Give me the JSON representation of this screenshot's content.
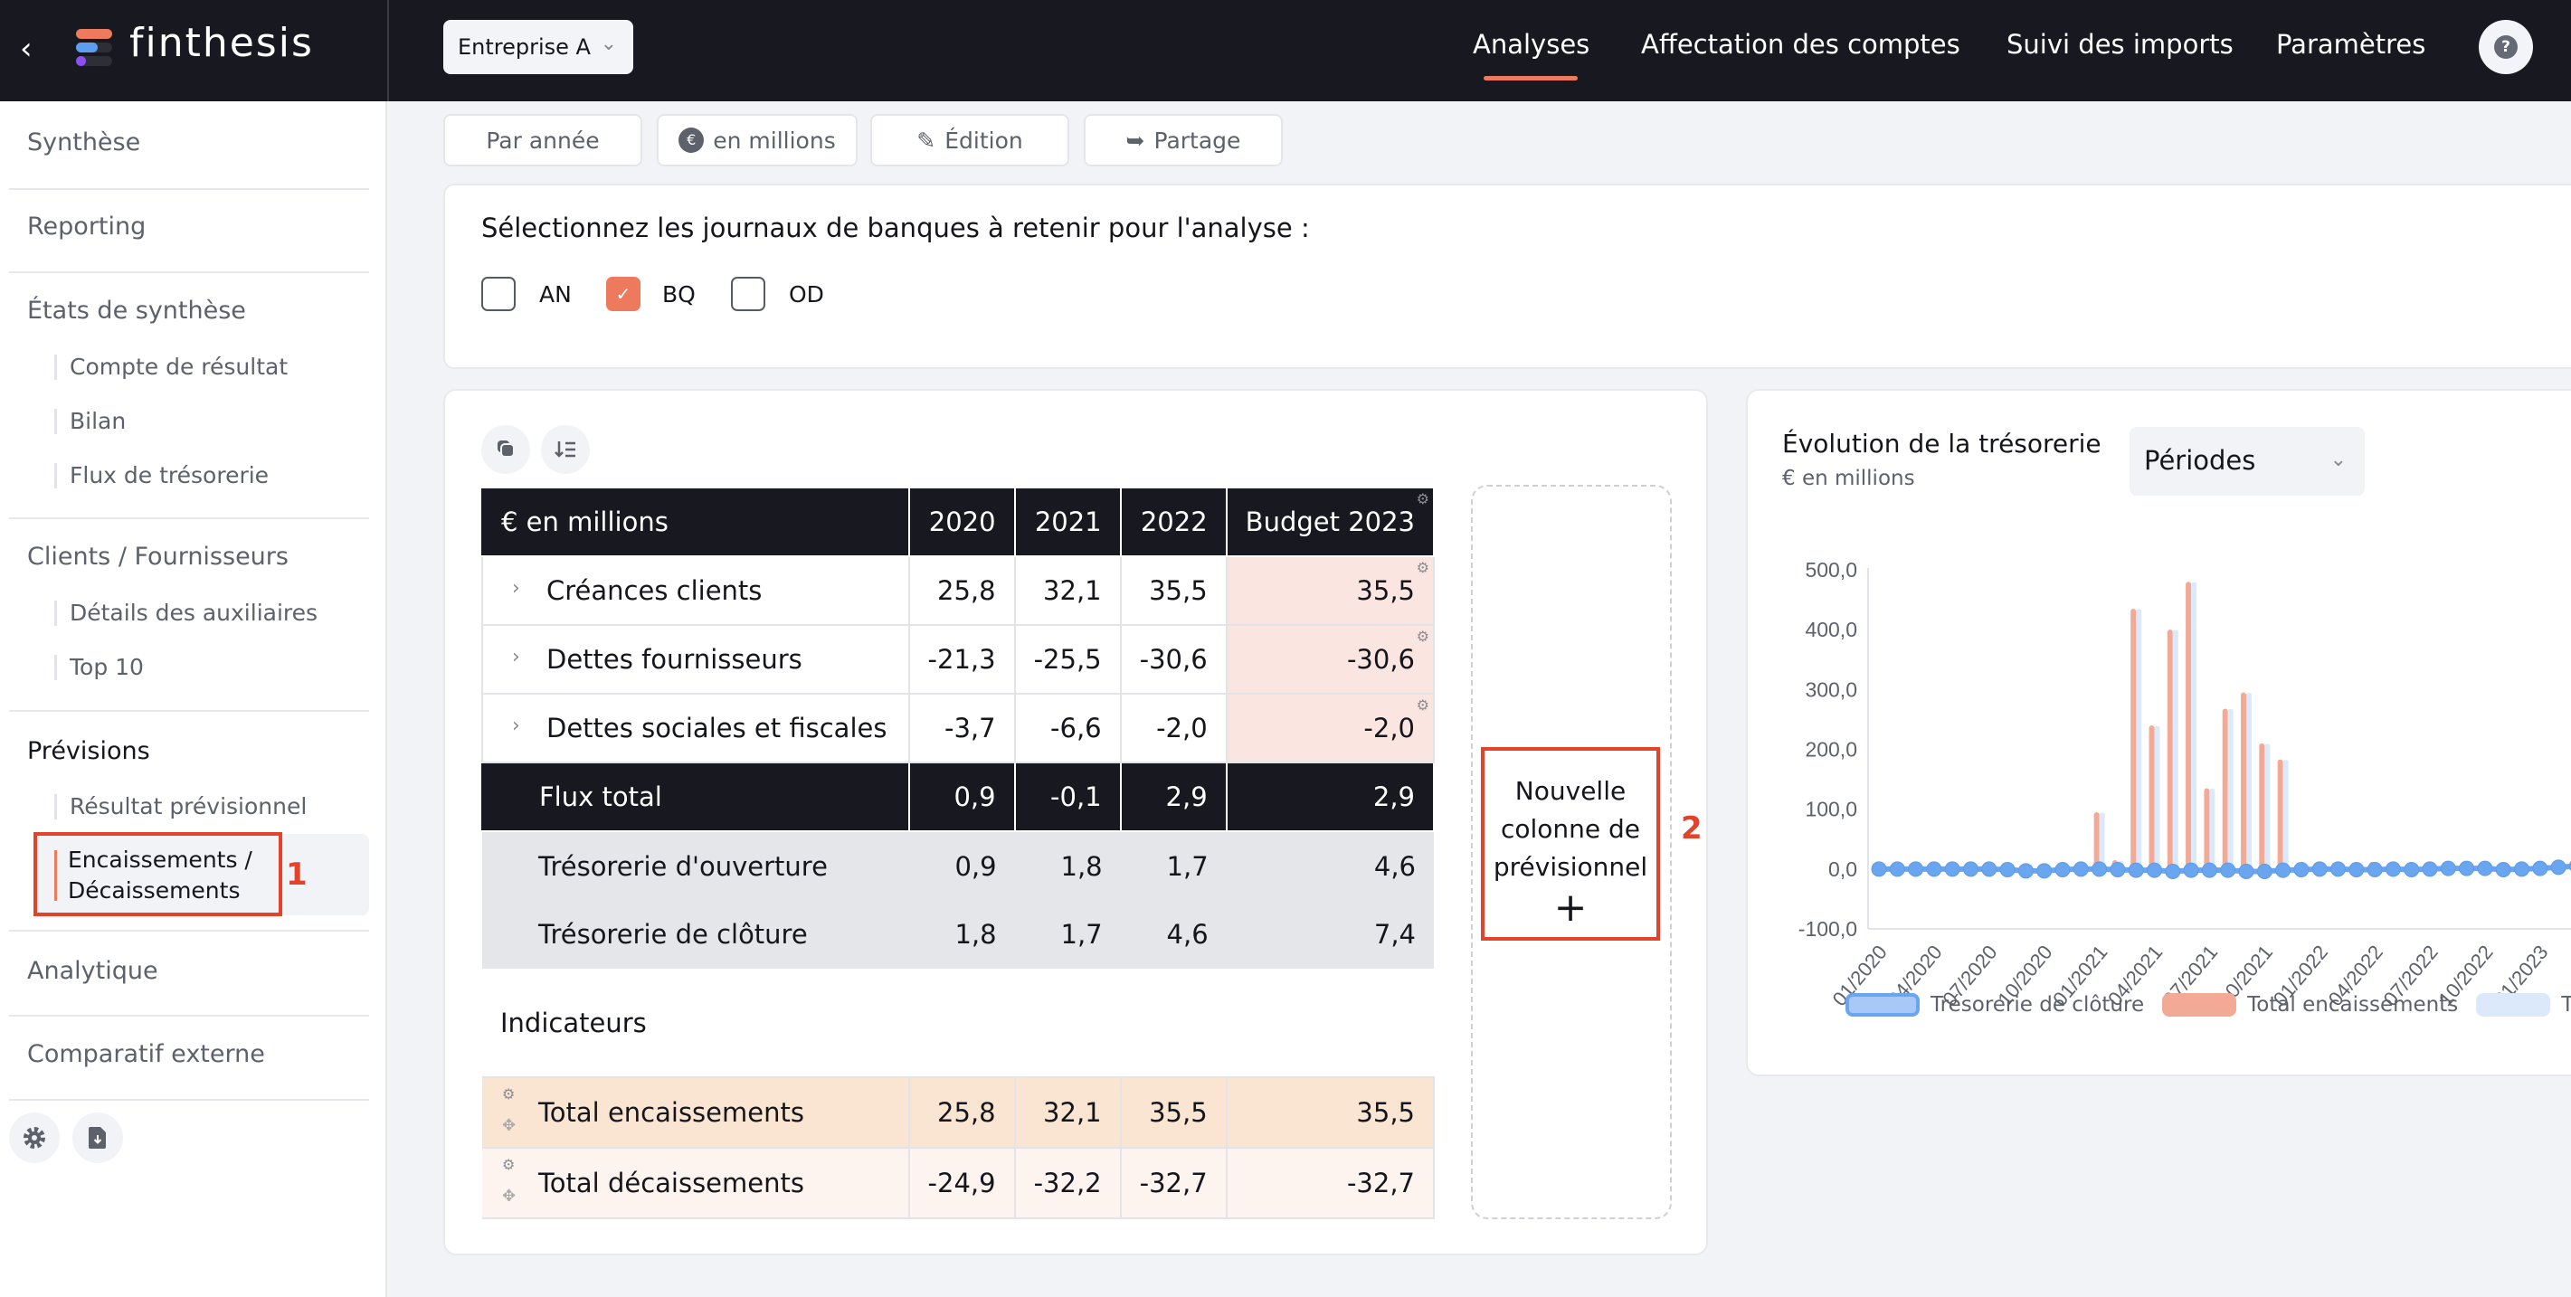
{
  "header": {
    "back_icon": "chevron-left-icon",
    "brand": "finthesis",
    "company": "Entreprise A",
    "nav": [
      {
        "label": "Analyses",
        "active": true
      },
      {
        "label": "Affectation des comptes",
        "active": false
      },
      {
        "label": "Suivi des imports",
        "active": false
      },
      {
        "label": "Paramètres",
        "active": false
      }
    ],
    "help_icon": "?"
  },
  "sidebar": {
    "sections": [
      {
        "label": "Synthèse"
      },
      {
        "label": "Reporting"
      },
      {
        "label": "États de synthèse",
        "children": [
          "Compte de résultat",
          "Bilan",
          "Flux de trésorerie"
        ]
      },
      {
        "label": "Clients / Fournisseurs",
        "children": [
          "Détails des auxiliaires",
          "Top 10"
        ]
      },
      {
        "label": "Prévisions",
        "children": [
          "Résultat prévisionnel",
          "Encaissements / Décaissements"
        ]
      },
      {
        "label": "Analytique"
      },
      {
        "label": "Comparatif externe"
      }
    ],
    "active_item": "Encaissements / Décaissements",
    "active_line1": "Encaissements /",
    "active_line2": "Décaissements"
  },
  "annotations": [
    "1",
    "2"
  ],
  "toolbar": {
    "period": "Par année",
    "unit": "en millions",
    "unit_icon": "€",
    "edit": "Édition",
    "share": "Partage"
  },
  "journals": {
    "question": "Sélectionnez les journaux de banques à retenir pour l'analyse :",
    "options": [
      {
        "label": "AN",
        "checked": false
      },
      {
        "label": "BQ",
        "checked": true
      },
      {
        "label": "OD",
        "checked": false
      }
    ]
  },
  "table": {
    "header": [
      "€ en millions",
      "2020",
      "2021",
      "2022",
      "Budget 2023"
    ],
    "items": [
      {
        "label": "Créances clients",
        "values": [
          "25,8",
          "32,1",
          "35,5",
          "35,5"
        ]
      },
      {
        "label": "Dettes fournisseurs",
        "values": [
          "-21,3",
          "-25,5",
          "-30,6",
          "-30,6"
        ]
      },
      {
        "label": "Dettes sociales et fiscales",
        "values": [
          "-3,7",
          "-6,6",
          "-2,0",
          "-2,0"
        ]
      }
    ],
    "total": {
      "label": "Flux total",
      "values": [
        "0,9",
        "-0,1",
        "2,9",
        "2,9"
      ]
    },
    "cash": [
      {
        "label": "Trésorerie d'ouverture",
        "values": [
          "0,9",
          "1,8",
          "1,7",
          "4,6"
        ]
      },
      {
        "label": "Trésorerie de clôture",
        "values": [
          "1,8",
          "1,7",
          "4,6",
          "7,4"
        ]
      }
    ],
    "indicators_label": "Indicateurs",
    "indicators": [
      {
        "label": "Total encaissements",
        "values": [
          "25,8",
          "32,1",
          "35,5",
          "35,5"
        ]
      },
      {
        "label": "Total décaissements",
        "values": [
          "-24,9",
          "-32,2",
          "-32,7",
          "-32,7"
        ]
      }
    ]
  },
  "new_column": {
    "line1": "Nouvelle",
    "line2": "colonne de",
    "line3": "prévisionnel",
    "plus": "+"
  },
  "chart_panel": {
    "title": "Évolution de la trésorerie",
    "subtitle": "€ en millions",
    "period_select": "Périodes"
  },
  "chart_data": {
    "type": "bar",
    "title": "Évolution de la trésorerie",
    "ylabel": "€ en millions",
    "ylim": [
      -100,
      500
    ],
    "yticks": [
      "500,0",
      "400,0",
      "300,0",
      "200,0",
      "100,0",
      "0,0",
      "-100,0"
    ],
    "ytick_values": [
      500,
      400,
      300,
      200,
      100,
      0,
      -100
    ],
    "xtick_labels": [
      "01/2020",
      "04/2020",
      "07/2020",
      "10/2020",
      "01/2021",
      "04/2021",
      "07/2021",
      "10/2021",
      "01/2022",
      "04/2022",
      "07/2022",
      "10/2022",
      "01/2023"
    ],
    "x": [
      "01/2020",
      "02/2020",
      "03/2020",
      "04/2020",
      "05/2020",
      "06/2020",
      "07/2020",
      "08/2020",
      "09/2020",
      "10/2020",
      "11/2020",
      "12/2020",
      "01/2021",
      "02/2021",
      "03/2021",
      "04/2021",
      "05/2021",
      "06/2021",
      "07/2021",
      "08/2021",
      "09/2021",
      "10/2021",
      "11/2021",
      "12/2021",
      "01/2022",
      "02/2022",
      "03/2022",
      "04/2022",
      "05/2022",
      "06/2022",
      "07/2022",
      "08/2022",
      "09/2022",
      "10/2022",
      "11/2022",
      "12/2022",
      "01/2023",
      "02/2023",
      "03/2023",
      "04/2023"
    ],
    "series": [
      {
        "name": "Trésorerie de clôture",
        "type": "line",
        "color": "#6aa6ef",
        "values": [
          0,
          0,
          0,
          0,
          0,
          0,
          0,
          -1,
          -3,
          -3,
          -1,
          0,
          0,
          -1,
          -2,
          -2,
          -4,
          -2,
          -2,
          -2,
          -4,
          -4,
          -2,
          -1,
          0,
          0,
          -1,
          -1,
          0,
          -1,
          0,
          1,
          1,
          1,
          -1,
          0,
          1,
          3,
          5,
          6
        ]
      },
      {
        "name": "Total encaissements",
        "type": "bar",
        "color": "#f2aa97",
        "values": [
          0,
          0,
          3,
          0,
          0,
          0,
          0,
          0,
          0,
          0,
          0,
          0,
          95,
          15,
          435,
          240,
          400,
          480,
          135,
          268,
          295,
          210,
          183,
          0,
          0,
          0,
          0,
          12,
          0,
          8,
          0,
          0,
          0,
          5,
          4,
          0,
          0,
          0,
          0,
          0
        ]
      },
      {
        "name": "Total décaissements",
        "type": "bar",
        "color": "#dce9fb",
        "values": [
          0,
          0,
          2,
          0,
          0,
          0,
          0,
          0,
          0,
          0,
          0,
          0,
          94,
          14,
          434,
          239,
          399,
          479,
          134,
          267,
          294,
          209,
          182,
          0,
          0,
          0,
          0,
          10,
          0,
          7,
          0,
          0,
          0,
          4,
          3,
          0,
          0,
          0,
          0,
          0
        ]
      }
    ],
    "legend": [
      "Trésorerie de clôture",
      "Total encaissements",
      "Total décaissements"
    ],
    "legend_visible": [
      "Trésorerie de clôture",
      "Total encaissements",
      "Tota"
    ],
    "legend_position": "bottom",
    "grid": false
  },
  "colors": {
    "accent": "#ee7a5e",
    "dark": "#181920",
    "annotation": "#e4432b",
    "budget_cell": "#fae5e0",
    "encaissements_row": "#fae5d2",
    "decaissements_row": "#fdf4ef"
  }
}
